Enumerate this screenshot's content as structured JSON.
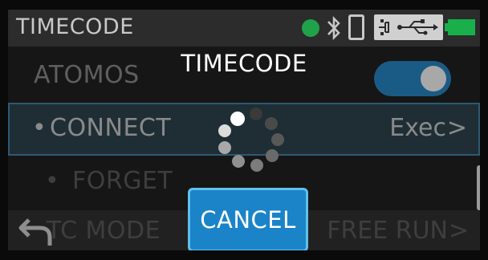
{
  "header": {
    "title": "TIMECODE",
    "icons": [
      "status-dot",
      "bluetooth-icon",
      "phone-icon",
      "usb-icon",
      "battery-icon"
    ],
    "status_color": "#1fa24a",
    "battery_color": "#19b04c"
  },
  "menu": {
    "atomos": {
      "label": "ATOMOS",
      "toggle_on": true
    },
    "connect": {
      "bullet": "•",
      "label": "CONNECT",
      "value": "Exec",
      "chevron": ">"
    },
    "forget": {
      "bullet": "•",
      "label": "FORGET"
    },
    "tc_mode": {
      "label": "TC MODE",
      "value": "FREE RUN",
      "chevron": ">"
    }
  },
  "dialog": {
    "title": "TIMECODE",
    "cancel_label": "CANCEL",
    "accent": "#1b84c8"
  }
}
